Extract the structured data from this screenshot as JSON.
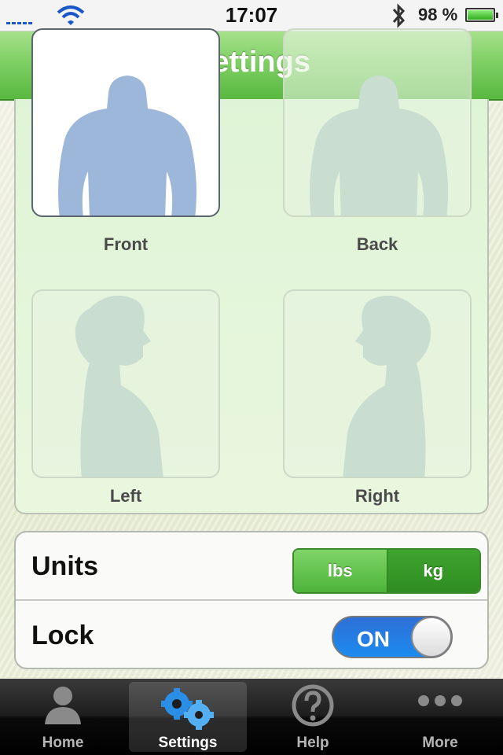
{
  "status_bar": {
    "time": "17:07",
    "battery_percent": "98 %"
  },
  "nav_bar": {
    "title": "Settings"
  },
  "photos": [
    {
      "label": "Front",
      "selected": true
    },
    {
      "label": "Back",
      "selected": false
    },
    {
      "label": "Left",
      "selected": false
    },
    {
      "label": "Right",
      "selected": false
    }
  ],
  "settings": {
    "units": {
      "label": "Units",
      "options": [
        "lbs",
        "kg"
      ],
      "selected": "kg"
    },
    "lock": {
      "label": "Lock",
      "value": "ON"
    }
  },
  "tab_bar": {
    "items": [
      {
        "label": "Home",
        "icon": "person-icon"
      },
      {
        "label": "Settings",
        "icon": "gears-icon",
        "selected": true
      },
      {
        "label": "Help",
        "icon": "question-icon"
      },
      {
        "label": "More",
        "icon": "more-icon"
      }
    ]
  },
  "colors": {
    "nav_green": "#7fd064",
    "toggle_blue": "#2f6fd6",
    "silhouette_active": "#9db7da",
    "silhouette_inactive": "#c9ddd0"
  }
}
